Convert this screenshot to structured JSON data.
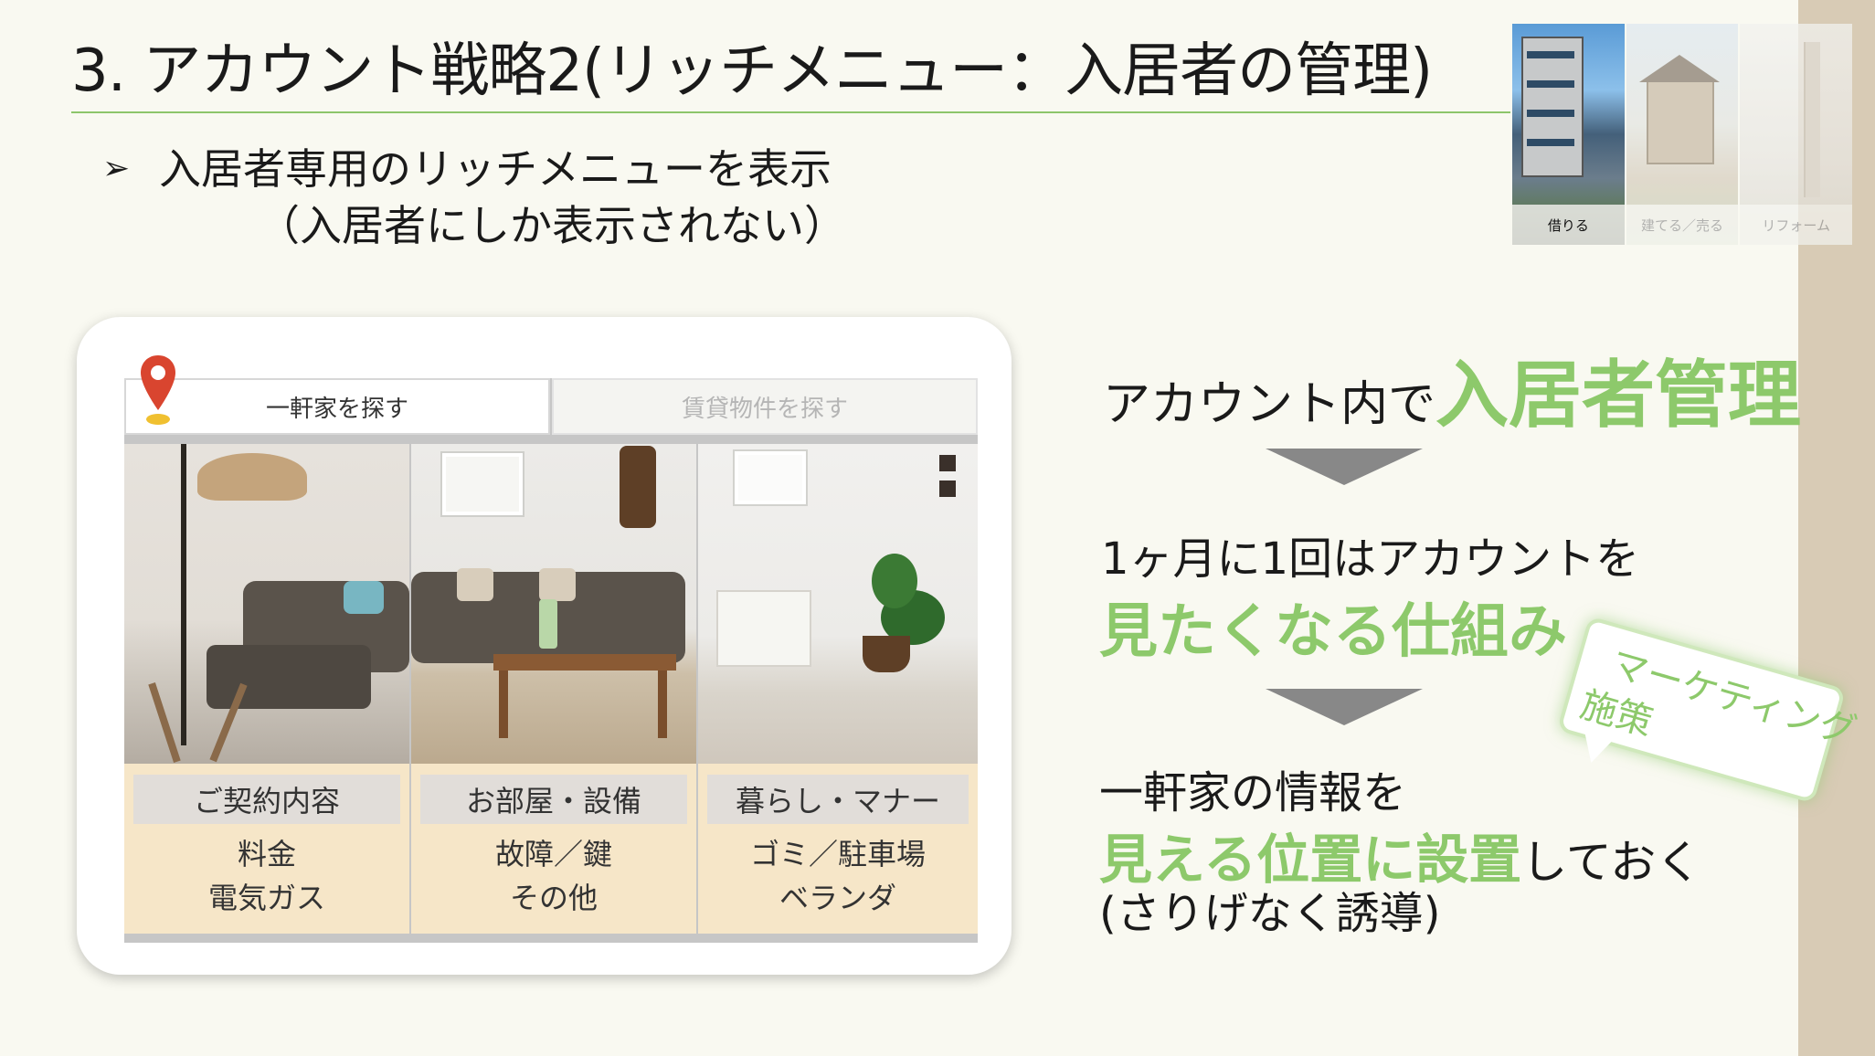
{
  "title": "3. アカウント戦略2(リッチメニュー：入居者の管理)",
  "bullet": {
    "line1": "入居者専用のリッチメニューを表示",
    "line2": "（入居者にしか表示されない）"
  },
  "thumbnails": [
    {
      "label": "借りる"
    },
    {
      "label": "建てる／売る"
    },
    {
      "label": "リフォーム"
    }
  ],
  "richmenu": {
    "tabs": [
      "一軒家を探す",
      "賃貸物件を探す"
    ],
    "panels": [
      {
        "title": "ご契約内容",
        "lines": [
          "料金",
          "電気ガス"
        ]
      },
      {
        "title": "お部屋・設備",
        "lines": [
          "故障／鍵",
          "その他"
        ]
      },
      {
        "title": "暮らし・マナー",
        "lines": [
          "ゴミ／駐車場",
          "ベランダ"
        ]
      }
    ]
  },
  "flow": {
    "step1_prefix": "アカウント内で",
    "step1_emphasis": "入居者管理",
    "step2_line1": "1ヶ月に1回はアカウントを",
    "step2_emphasis": "見たくなる仕組み",
    "step3_line1": "一軒家の情報を",
    "step3_emphasis": "見える位置に設置",
    "step3_suffix": "しておく",
    "step3_note": "(さりげなく誘導)"
  },
  "bubble": {
    "line1": "マーケティング",
    "line2": "施策"
  },
  "colors": {
    "accent_green": "#8dc96b",
    "side_band": "#d8cbb5",
    "panel_beige": "#f6e6c8",
    "background": "#f9f9f1"
  }
}
